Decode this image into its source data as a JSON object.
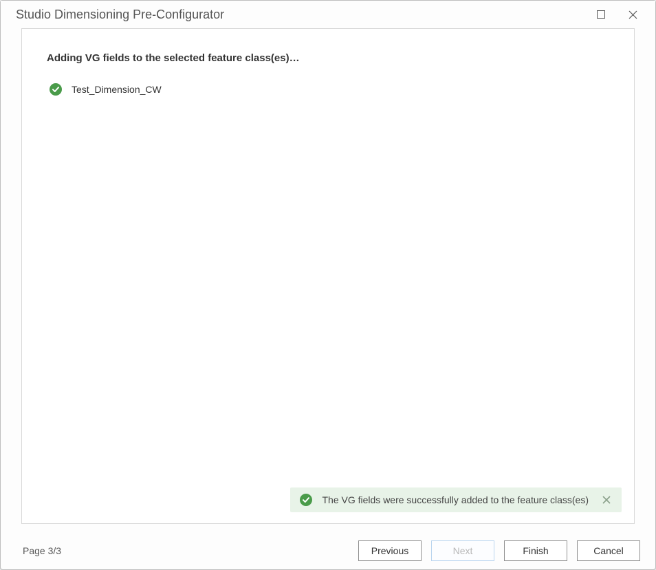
{
  "window": {
    "title": "Studio Dimensioning Pre-Configurator"
  },
  "content": {
    "heading": "Adding VG fields to the selected feature class(es)…",
    "items": [
      {
        "label": "Test_Dimension_CW"
      }
    ]
  },
  "status": {
    "message": "The VG fields were successfully added to the feature class(es)"
  },
  "footer": {
    "page_label": "Page 3/3",
    "previous": "Previous",
    "next": "Next",
    "finish": "Finish",
    "cancel": "Cancel"
  },
  "colors": {
    "success_green": "#4a9b4a",
    "banner_bg": "#e8f3e8"
  }
}
